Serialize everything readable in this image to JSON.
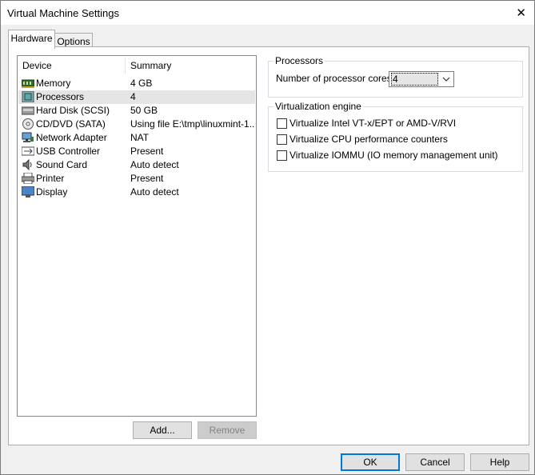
{
  "window": {
    "title": "Virtual Machine Settings"
  },
  "tabs": [
    {
      "label": "Hardware"
    },
    {
      "label": "Options"
    }
  ],
  "device_list": {
    "headers": {
      "device": "Device",
      "summary": "Summary"
    },
    "rows": [
      {
        "name": "Memory",
        "summary": "4 GB",
        "icon": "memory-icon"
      },
      {
        "name": "Processors",
        "summary": "4",
        "icon": "processor-icon"
      },
      {
        "name": "Hard Disk (SCSI)",
        "summary": "50 GB",
        "icon": "hard-disk-icon"
      },
      {
        "name": "CD/DVD (SATA)",
        "summary": "Using file E:\\tmp\\linuxmint-1...",
        "icon": "cd-dvd-icon"
      },
      {
        "name": "Network Adapter",
        "summary": "NAT",
        "icon": "network-adapter-icon"
      },
      {
        "name": "USB Controller",
        "summary": "Present",
        "icon": "usb-icon"
      },
      {
        "name": "Sound Card",
        "summary": "Auto detect",
        "icon": "sound-card-icon"
      },
      {
        "name": "Printer",
        "summary": "Present",
        "icon": "printer-icon"
      },
      {
        "name": "Display",
        "summary": "Auto detect",
        "icon": "display-icon"
      }
    ],
    "selected_index": 1
  },
  "list_buttons": {
    "add": "Add...",
    "remove": "Remove"
  },
  "processors": {
    "group_title": "Processors",
    "cores_label": "Number of processor cores:",
    "cores_value": "4"
  },
  "virtualization": {
    "group_title": "Virtualization engine",
    "options": [
      {
        "label": "Virtualize Intel VT-x/EPT or AMD-V/RVI",
        "checked": false
      },
      {
        "label": "Virtualize CPU performance counters",
        "checked": false
      },
      {
        "label": "Virtualize IOMMU (IO memory management unit)",
        "checked": false
      }
    ]
  },
  "footer": {
    "ok": "OK",
    "cancel": "Cancel",
    "help": "Help"
  }
}
